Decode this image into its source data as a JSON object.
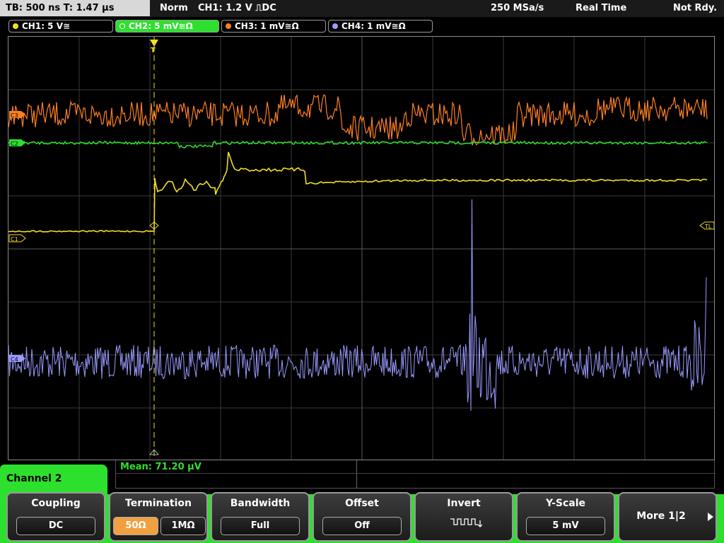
{
  "status": {
    "timebase": "TB: 500 ns   T: 1.47 µs",
    "mode": "Norm",
    "trigger": "CH1: 1.2 V ⎍DC",
    "rate": "250 MSa/s",
    "acq": "Real Time",
    "state": "Not Rdy."
  },
  "channels": [
    {
      "label": "CH1: 5 V≅",
      "color": "#f0e020"
    },
    {
      "label": "CH2: 5 mV≅Ω",
      "color": "#33dd33"
    },
    {
      "label": "CH3: 1 mV≅Ω",
      "color": "#ff8020"
    },
    {
      "label": "CH4: 1 mV≅Ω",
      "color": "#9a9aff"
    }
  ],
  "markers": {
    "c3": "C3",
    "c2": "C2",
    "c1": "C1",
    "c4": "C4",
    "tl": "TL"
  },
  "readout": {
    "mean": "Mean: 71.20 µV"
  },
  "menu": {
    "title": "Channel 2",
    "coupling": {
      "label": "Coupling",
      "value": "DC"
    },
    "termination": {
      "label": "Termination",
      "opt1": "50Ω",
      "opt2": "1MΩ"
    },
    "bandwidth": {
      "label": "Bandwidth",
      "value": "Full"
    },
    "offset": {
      "label": "Offset",
      "value": "Off"
    },
    "invert": {
      "label": "Invert"
    },
    "yscale": {
      "label": "Y-Scale",
      "value": "5 mV"
    },
    "more": {
      "label": "More 1|2"
    }
  }
}
